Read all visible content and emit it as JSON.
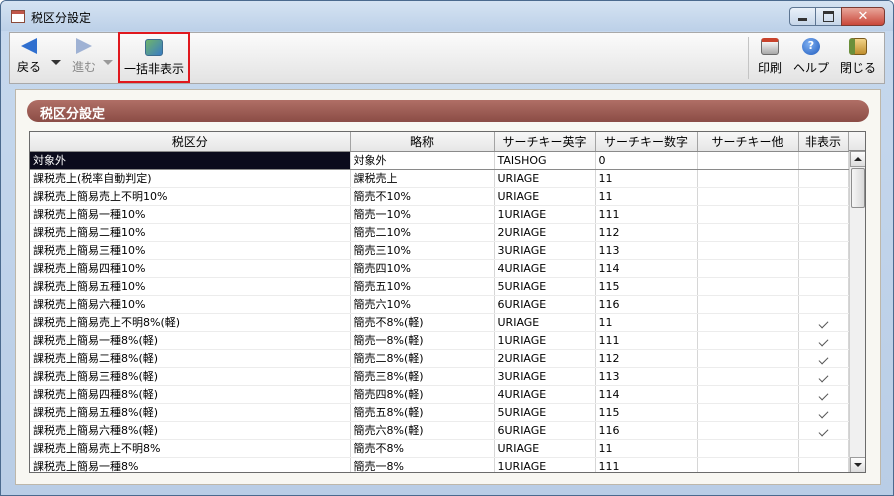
{
  "window": {
    "title": "税区分設定"
  },
  "toolbar": {
    "back_label": "戻る",
    "forward_label": "進む",
    "hide_all_label": "一括非表示",
    "print_label": "印刷",
    "help_label": "ヘルプ",
    "close_label": "閉じる",
    "help_glyph": "?"
  },
  "section": {
    "title": "税区分設定"
  },
  "table": {
    "headers": [
      "税区分",
      "略称",
      "サーチキー英字",
      "サーチキー数字",
      "サーチキー他",
      "非表示"
    ],
    "rows": [
      {
        "name": "対象外",
        "abbr": "対象外",
        "key_alpha": "TAISHOG",
        "key_num": "0",
        "key_other": "",
        "hidden": false
      },
      {
        "name": "課税売上(税率自動判定)",
        "abbr": "課税売上",
        "key_alpha": "URIAGE",
        "key_num": "11",
        "key_other": "",
        "hidden": false
      },
      {
        "name": "課税売上簡易売上不明10%",
        "abbr": "簡売不10%",
        "key_alpha": "URIAGE",
        "key_num": "11",
        "key_other": "",
        "hidden": false
      },
      {
        "name": "課税売上簡易一種10%",
        "abbr": "簡売一10%",
        "key_alpha": "1URIAGE",
        "key_num": "111",
        "key_other": "",
        "hidden": false
      },
      {
        "name": "課税売上簡易二種10%",
        "abbr": "簡売二10%",
        "key_alpha": "2URIAGE",
        "key_num": "112",
        "key_other": "",
        "hidden": false
      },
      {
        "name": "課税売上簡易三種10%",
        "abbr": "簡売三10%",
        "key_alpha": "3URIAGE",
        "key_num": "113",
        "key_other": "",
        "hidden": false
      },
      {
        "name": "課税売上簡易四種10%",
        "abbr": "簡売四10%",
        "key_alpha": "4URIAGE",
        "key_num": "114",
        "key_other": "",
        "hidden": false
      },
      {
        "name": "課税売上簡易五種10%",
        "abbr": "簡売五10%",
        "key_alpha": "5URIAGE",
        "key_num": "115",
        "key_other": "",
        "hidden": false
      },
      {
        "name": "課税売上簡易六種10%",
        "abbr": "簡売六10%",
        "key_alpha": "6URIAGE",
        "key_num": "116",
        "key_other": "",
        "hidden": false
      },
      {
        "name": "課税売上簡易売上不明8%(軽)",
        "abbr": "簡売不8%(軽)",
        "key_alpha": "URIAGE",
        "key_num": "11",
        "key_other": "",
        "hidden": true
      },
      {
        "name": "課税売上簡易一種8%(軽)",
        "abbr": "簡売一8%(軽)",
        "key_alpha": "1URIAGE",
        "key_num": "111",
        "key_other": "",
        "hidden": true
      },
      {
        "name": "課税売上簡易二種8%(軽)",
        "abbr": "簡売二8%(軽)",
        "key_alpha": "2URIAGE",
        "key_num": "112",
        "key_other": "",
        "hidden": true
      },
      {
        "name": "課税売上簡易三種8%(軽)",
        "abbr": "簡売三8%(軽)",
        "key_alpha": "3URIAGE",
        "key_num": "113",
        "key_other": "",
        "hidden": true
      },
      {
        "name": "課税売上簡易四種8%(軽)",
        "abbr": "簡売四8%(軽)",
        "key_alpha": "4URIAGE",
        "key_num": "114",
        "key_other": "",
        "hidden": true
      },
      {
        "name": "課税売上簡易五種8%(軽)",
        "abbr": "簡売五8%(軽)",
        "key_alpha": "5URIAGE",
        "key_num": "115",
        "key_other": "",
        "hidden": true
      },
      {
        "name": "課税売上簡易六種8%(軽)",
        "abbr": "簡売六8%(軽)",
        "key_alpha": "6URIAGE",
        "key_num": "116",
        "key_other": "",
        "hidden": true
      },
      {
        "name": "課税売上簡易売上不明8%",
        "abbr": "簡売不8%",
        "key_alpha": "URIAGE",
        "key_num": "11",
        "key_other": "",
        "hidden": false
      },
      {
        "name": "課税売上簡易一種8%",
        "abbr": "簡売一8%",
        "key_alpha": "1URIAGE",
        "key_num": "111",
        "key_other": "",
        "hidden": false
      }
    ]
  }
}
